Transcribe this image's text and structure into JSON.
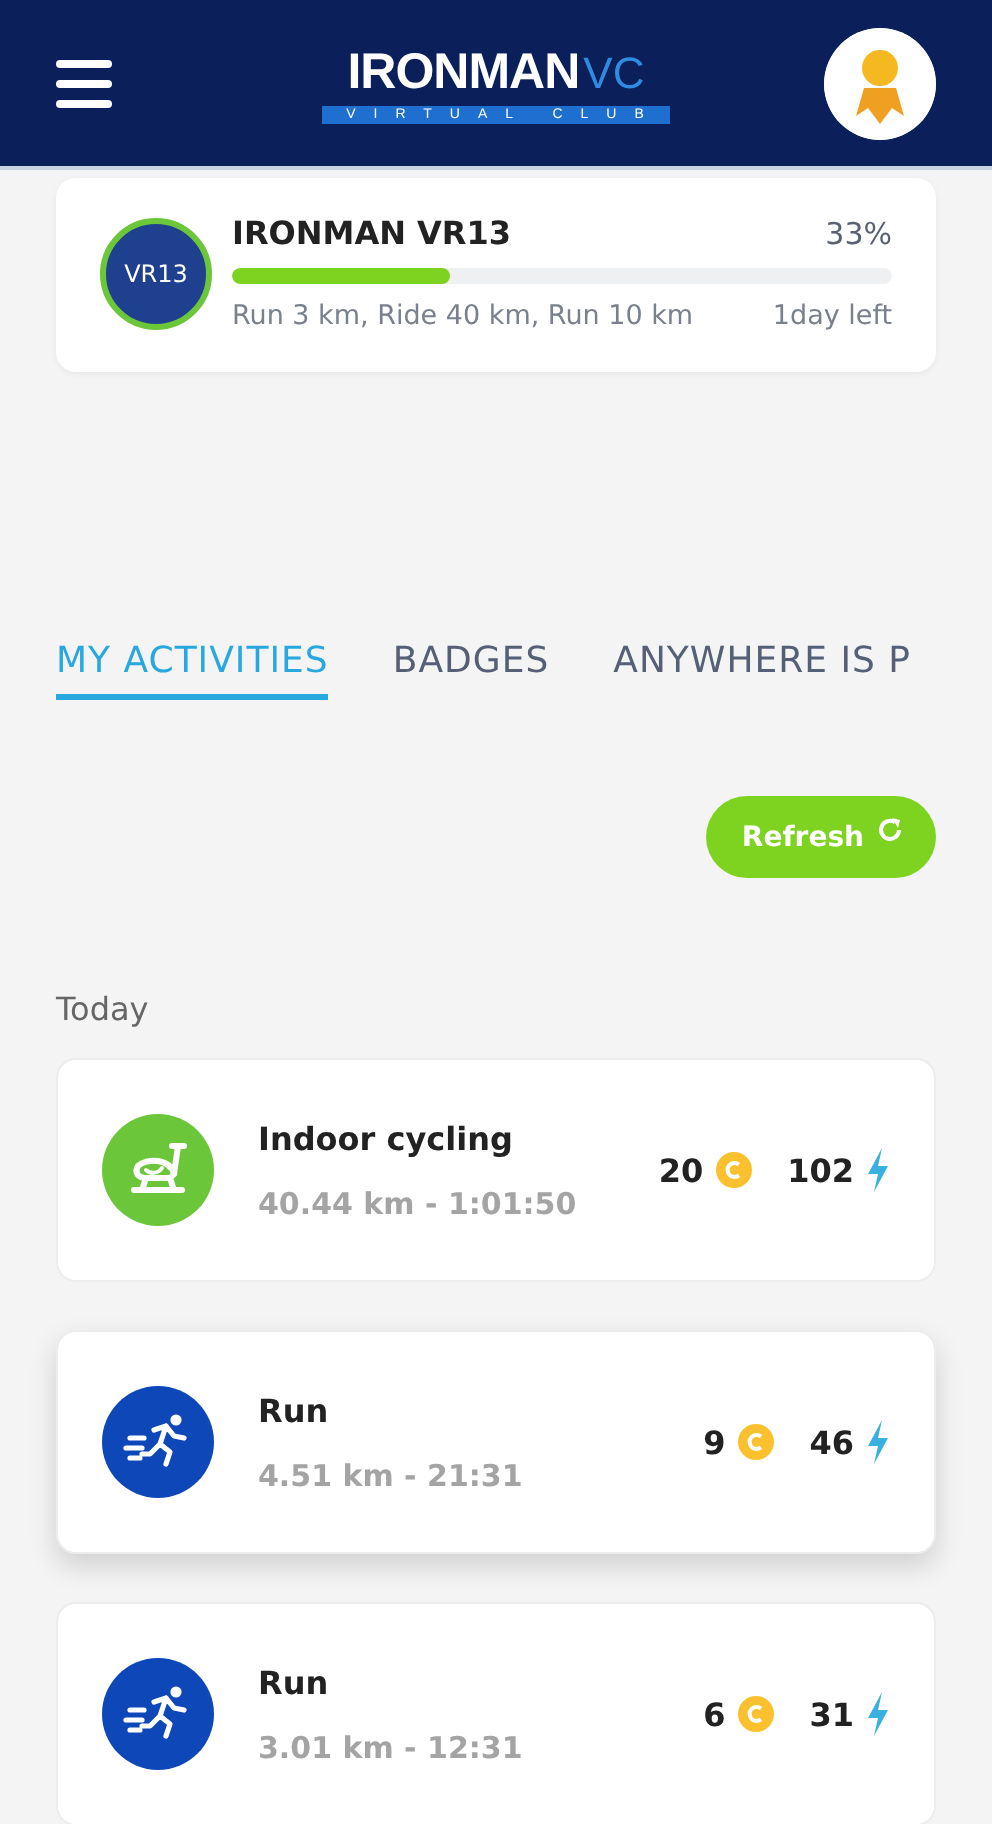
{
  "header": {
    "logo": {
      "word": "IRONMAN",
      "suffix": "VC",
      "tagline": "VIRTUAL CLUB"
    }
  },
  "challenge": {
    "badge": "VR13",
    "title": "IRONMAN VR13",
    "percent": "33%",
    "level": 0.33,
    "description": "Run 3 km, Ride 40 km, Run 10 km",
    "time_left": "1day left"
  },
  "tabs": [
    {
      "label": "MY ACTIVITIES",
      "selected": true
    },
    {
      "label": "BADGES",
      "selected": false
    },
    {
      "label": "ANYWHERE IS P",
      "selected": false
    }
  ],
  "refresh_button": "Refresh",
  "section_label": "Today",
  "activities": [
    {
      "kind": "cycling",
      "name": "Indoor cycling",
      "detail": "40.44 km - 1:01:50",
      "coins": "20",
      "energy": "102",
      "selected": false
    },
    {
      "kind": "run",
      "name": "Run",
      "detail": "4.51 km - 21:31",
      "coins": "9",
      "energy": "46",
      "selected": true
    },
    {
      "kind": "run",
      "name": "Run",
      "detail": "3.01 km - 12:31",
      "coins": "6",
      "energy": "31",
      "selected": false
    }
  ]
}
